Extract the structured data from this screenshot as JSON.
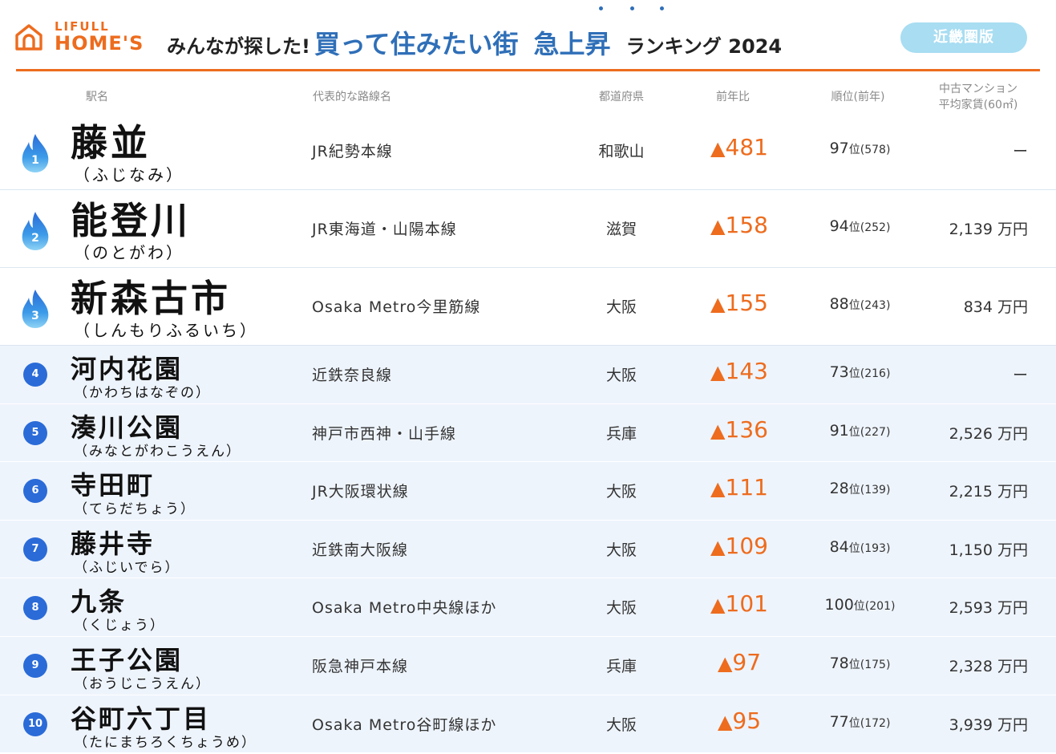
{
  "header": {
    "logo_top": "LIFULL",
    "logo_main": "HOME'S",
    "title_pre": "みんなが探した!",
    "title_main": "買って住みたい街",
    "title_accent": "急上昇",
    "title_post": "ランキング 2024",
    "region_button": "近畿圏版",
    "colors": {
      "brand": "#ED6C1E",
      "title_blue": "#2F6FB8",
      "region_button": "#A8DDF2",
      "rank_circle": "#2A6BD8"
    }
  },
  "columns": {
    "station": "駅名",
    "line": "代表的な路線名",
    "prefecture": "都道府県",
    "change": "前年比",
    "rank": "順位(前年)",
    "rent_line1": "中古マンション",
    "rent_line2": "平均家賃(60㎡)"
  },
  "rows": [
    {
      "rank_no": "1",
      "station": "藤並",
      "reading": "（ふじなみ）",
      "line": "JR紀勢本線",
      "prefecture": "和歌山",
      "change_mark": "▲",
      "change": "481",
      "rank": "97",
      "rank_unit": "位",
      "prev_rank": "(578)",
      "rent": "ー"
    },
    {
      "rank_no": "2",
      "station": "能登川",
      "reading": "（のとがわ）",
      "line": "JR東海道・山陽本線",
      "prefecture": "滋賀",
      "change_mark": "▲",
      "change": "158",
      "rank": "94",
      "rank_unit": "位",
      "prev_rank": "(252)",
      "rent": "2,139 万円"
    },
    {
      "rank_no": "3",
      "station": "新森古市",
      "reading": "（しんもりふるいち）",
      "line": "Osaka Metro今里筋線",
      "prefecture": "大阪",
      "change_mark": "▲",
      "change": "155",
      "rank": "88",
      "rank_unit": "位",
      "prev_rank": "(243)",
      "rent": "834 万円"
    },
    {
      "rank_no": "4",
      "station": "河内花園",
      "reading": "（かわちはなぞの）",
      "line": "近鉄奈良線",
      "prefecture": "大阪",
      "change_mark": "▲",
      "change": "143",
      "rank": "73",
      "rank_unit": "位",
      "prev_rank": "(216)",
      "rent": "ー"
    },
    {
      "rank_no": "5",
      "station": "湊川公園",
      "reading": "（みなとがわこうえん）",
      "line": "神戸市西神・山手線",
      "prefecture": "兵庫",
      "change_mark": "▲",
      "change": "136",
      "rank": "91",
      "rank_unit": "位",
      "prev_rank": "(227)",
      "rent": "2,526 万円"
    },
    {
      "rank_no": "6",
      "station": "寺田町",
      "reading": "（てらだちょう）",
      "line": "JR大阪環状線",
      "prefecture": "大阪",
      "change_mark": "▲",
      "change": "111",
      "rank": "28",
      "rank_unit": "位",
      "prev_rank": "(139)",
      "rent": "2,215 万円"
    },
    {
      "rank_no": "7",
      "station": "藤井寺",
      "reading": "（ふじいでら）",
      "line": "近鉄南大阪線",
      "prefecture": "大阪",
      "change_mark": "▲",
      "change": "109",
      "rank": "84",
      "rank_unit": "位",
      "prev_rank": "(193)",
      "rent": "1,150 万円"
    },
    {
      "rank_no": "8",
      "station": "九条",
      "reading": "（くじょう）",
      "line": "Osaka Metro中央線ほか",
      "prefecture": "大阪",
      "change_mark": "▲",
      "change": "101",
      "rank": "100",
      "rank_unit": "位",
      "prev_rank": "(201)",
      "rent": "2,593 万円"
    },
    {
      "rank_no": "9",
      "station": "王子公園",
      "reading": "（おうじこうえん）",
      "line": "阪急神戸本線",
      "prefecture": "兵庫",
      "change_mark": "▲",
      "change": "97",
      "rank": "78",
      "rank_unit": "位",
      "prev_rank": "(175)",
      "rent": "2,328 万円"
    },
    {
      "rank_no": "10",
      "station": "谷町六丁目",
      "reading": "（たにまちろくちょうめ）",
      "line": "Osaka Metro谷町線ほか",
      "prefecture": "大阪",
      "change_mark": "▲",
      "change": "95",
      "rank": "77",
      "rank_unit": "位",
      "prev_rank": "(172)",
      "rent": "3,939 万円"
    }
  ]
}
